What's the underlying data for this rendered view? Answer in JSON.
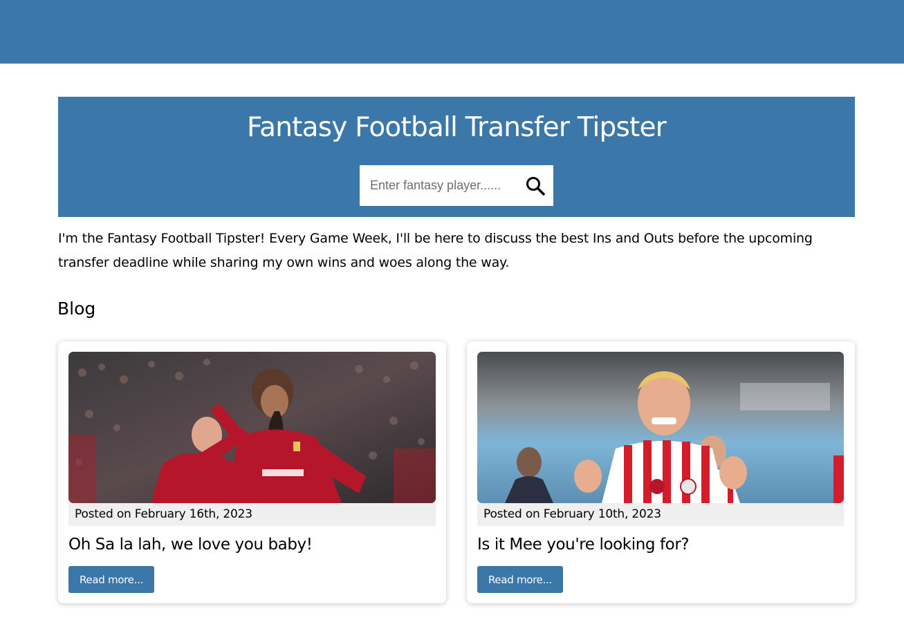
{
  "hero": {
    "title": "Fantasy Football Transfer Tipster",
    "search": {
      "placeholder": "Enter fantasy player......",
      "value": "",
      "icon": "search-icon"
    }
  },
  "intro": "I'm the Fantasy Football Tipster! Every Game Week, I'll be here to discuss the best Ins and Outs before the upcoming transfer deadline while sharing my own wins and woes along the way.",
  "blog": {
    "heading": "Blog",
    "posts": [
      {
        "posted": "Posted on February 16th, 2023",
        "title": "Oh Sa la lah, we love you baby!",
        "button": "Read more..."
      },
      {
        "posted": "Posted on February 10th, 2023",
        "title": "Is it Mee you're looking for?",
        "button": "Read more..."
      }
    ]
  },
  "colors": {
    "brand": "#3b77a9",
    "posted_bg": "#efefef",
    "kit_red": "#b5162a"
  }
}
